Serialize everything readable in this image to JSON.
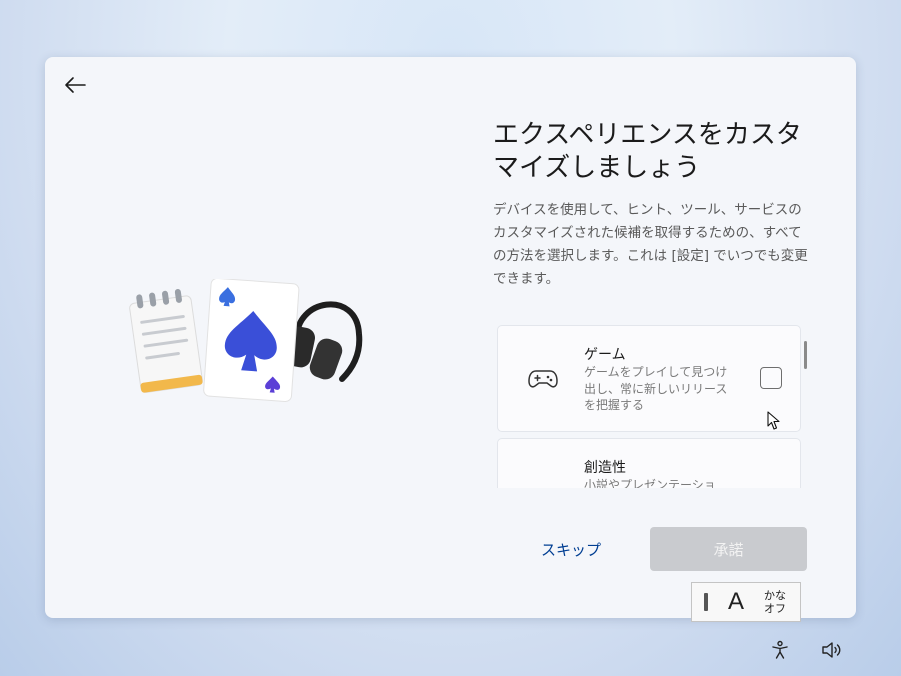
{
  "page": {
    "title": "エクスペリエンスをカスタマイズしましょう",
    "description": "デバイスを使用して、ヒント、ツール、サービスのカスタマイズされた候補を取得するための、すべての方法を選択します。これは [設定] でいつでも変更できます。"
  },
  "options": [
    {
      "title": "ゲーム",
      "description": "ゲームをプレイして見つけ出し、常に新しいリリースを把握する",
      "icon": "gamepad-icon",
      "checked": false
    },
    {
      "title": "創造性",
      "description": "小説やプレゼンテーショ",
      "icon": "creativity-icon",
      "checked": false
    }
  ],
  "buttons": {
    "skip": "スキップ",
    "accept": "承諾"
  },
  "ime": {
    "mode": "A",
    "kana_line1": "かな",
    "kana_line2": "オフ"
  },
  "icons": {
    "back": "back-arrow-icon",
    "accessibility": "accessibility-icon",
    "volume": "volume-icon"
  },
  "colors": {
    "link": "#003e92",
    "disabled_button": "#c9cbcf",
    "spade": "#3a4fd8"
  }
}
